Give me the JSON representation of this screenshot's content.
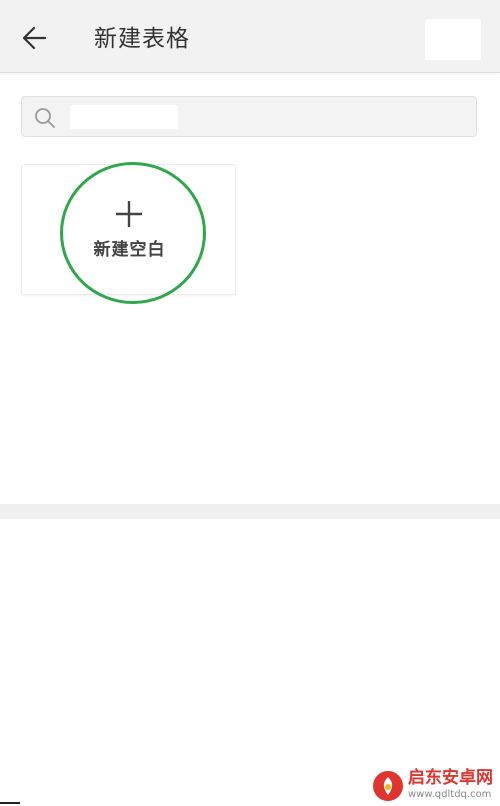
{
  "header": {
    "title": "新建表格",
    "back_icon": "arrow-left-icon"
  },
  "search": {
    "icon": "search-icon",
    "value": "",
    "placeholder": ""
  },
  "templates": [
    {
      "label": "新建空白",
      "icon": "plus-icon"
    }
  ],
  "colors": {
    "header_bg": "#f2f2f2",
    "highlight_ring": "#2ea84a",
    "title_text": "#333333",
    "watermark_red": "#e0342f"
  },
  "watermark": {
    "name": "启东安卓网",
    "url": "www.qdltdq.com"
  }
}
